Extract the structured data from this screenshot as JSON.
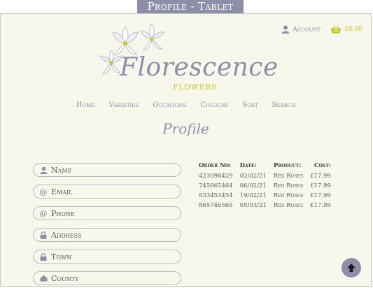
{
  "caption": "Profile - Tablet",
  "header": {
    "account_label": "Account",
    "basket_total": "£0.00",
    "logo_text": "Florescence",
    "logo_sub": "FLOWERS"
  },
  "nav": {
    "home": "Home",
    "varieties": "Varieties",
    "occasions": "Occasions",
    "colours": "Colours",
    "sort": "Sort",
    "search": "Search"
  },
  "page_title": "Profile",
  "form": {
    "name": "Name",
    "email": "Email",
    "phone": "Phone",
    "address": "Address",
    "town": "Town",
    "county": "County"
  },
  "orders": {
    "headers": [
      "Order No:",
      "Date:",
      "Product:",
      "Cost:"
    ],
    "rows": [
      [
        "423098429",
        "02/02/21",
        "Red Roses",
        "£17.99"
      ],
      [
        "745665464",
        "06/02/21",
        "Red Roses",
        "£17.99"
      ],
      [
        "833453454",
        "19/02/21",
        "Red Roses",
        "£17.99"
      ],
      [
        "865746565",
        "05/03/21",
        "Red Roses",
        "£17.99"
      ]
    ]
  },
  "colors": {
    "brand": "#8d8fa8",
    "accent": "#c6c62a",
    "background": "#f7f7ec"
  },
  "icons": {
    "account": "user-icon",
    "basket": "basket-icon",
    "email": "at-icon",
    "address": "lock-icon",
    "back_to_top": "arrow-up-icon"
  }
}
